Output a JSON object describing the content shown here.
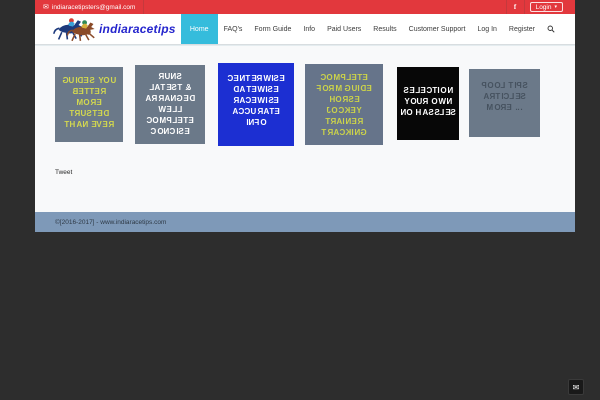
{
  "topbar": {
    "email": "indiaracetipsters@gmail.com",
    "facebook_glyph": "f",
    "login_label": "Login"
  },
  "header": {
    "brand": "indiaracetips",
    "nav": [
      {
        "label": "Home",
        "active": true
      },
      {
        "label": "FAQ's",
        "active": false
      },
      {
        "label": "Form Guide",
        "active": false
      },
      {
        "label": "Info",
        "active": false
      },
      {
        "label": "Paid Users",
        "active": false
      },
      {
        "label": "Results",
        "active": false
      },
      {
        "label": "Customer Support",
        "active": false
      },
      {
        "label": "Log In",
        "active": false
      },
      {
        "label": "Register",
        "active": false
      }
    ]
  },
  "tiles": [
    {
      "lines": [
        "GUIDES YOU",
        "BETTER",
        "MORE",
        "TRUSTED",
        "THAN EVER"
      ],
      "bg": "#6b7989",
      "color": "#d3d84f"
    },
    {
      "lines": [
        "RUNS",
        "LATEST &",
        "ARRANGED",
        "WELL",
        "COMPLETE",
        "CONCISE"
      ],
      "bg": "#6b7989",
      "color": "#ffffff"
    },
    {
      "lines": [
        "CENTERWISE",
        "DATEWISE",
        "RACEWISE",
        "ACCURATE",
        "INFO"
      ],
      "bg": "#1c2fd2",
      "color": "#ffffff"
    },
    {
      "lines": [
        "COMPLETE",
        "FORM GUIDE",
        "HORSE",
        "JOCKEY",
        "TRAINER",
        "TRACKING"
      ],
      "bg": "#66748a",
      "color": "#ccd34a"
    },
    {
      "lines": [
        "SELECTION",
        "YOUR OWN",
        "NO HASSLES"
      ],
      "bg": "#070707",
      "color": "#ffffff"
    },
    {
      "lines": [
        "POOL TIPS",
        "ARTICLES",
        "MORE ..."
      ],
      "bg": "#6b7989",
      "color": "#46525f"
    }
  ],
  "tweet_label": "Tweet",
  "footer": {
    "copyright": "©[2016-2017] - www.indiaracetips.com"
  },
  "icons": {
    "email_icon": "✉",
    "facebook_icon": "f",
    "login_caret": "▾",
    "search_icon": "magnifier",
    "logo_icon": "racing-horses",
    "contact_icon": "✉"
  },
  "colors": {
    "topbar_red": "#e2383d",
    "active_tab_cyan": "#35bcdc",
    "brand_blue": "#2525cd",
    "tile_gray": "#6b7989",
    "tile_blue": "#1c2fd2",
    "tile_black": "#070707",
    "footer_steel": "#7e99b8",
    "page_dark": "#2d2d2d"
  }
}
